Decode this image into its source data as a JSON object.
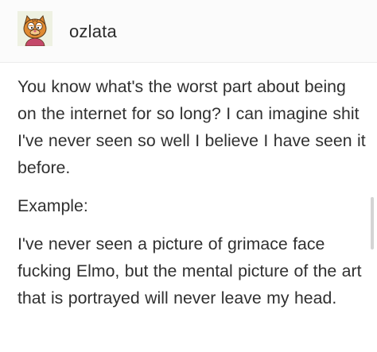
{
  "post": {
    "author": {
      "username": "ozlata",
      "avatar_icon": "cartoon-cat-avatar"
    },
    "paragraphs": [
      "You know what's the worst part about being on the internet for so long? I can imagine shit I've never seen so well I believe I have seen it before.",
      "Example:",
      "I've never seen a picture of grimace face fucking Elmo, but the mental picture of the art that is portrayed will never leave my head."
    ]
  },
  "colors": {
    "header_background": "#fbfbfb",
    "text": "#303030",
    "avatar_background": "#eef1e2"
  }
}
